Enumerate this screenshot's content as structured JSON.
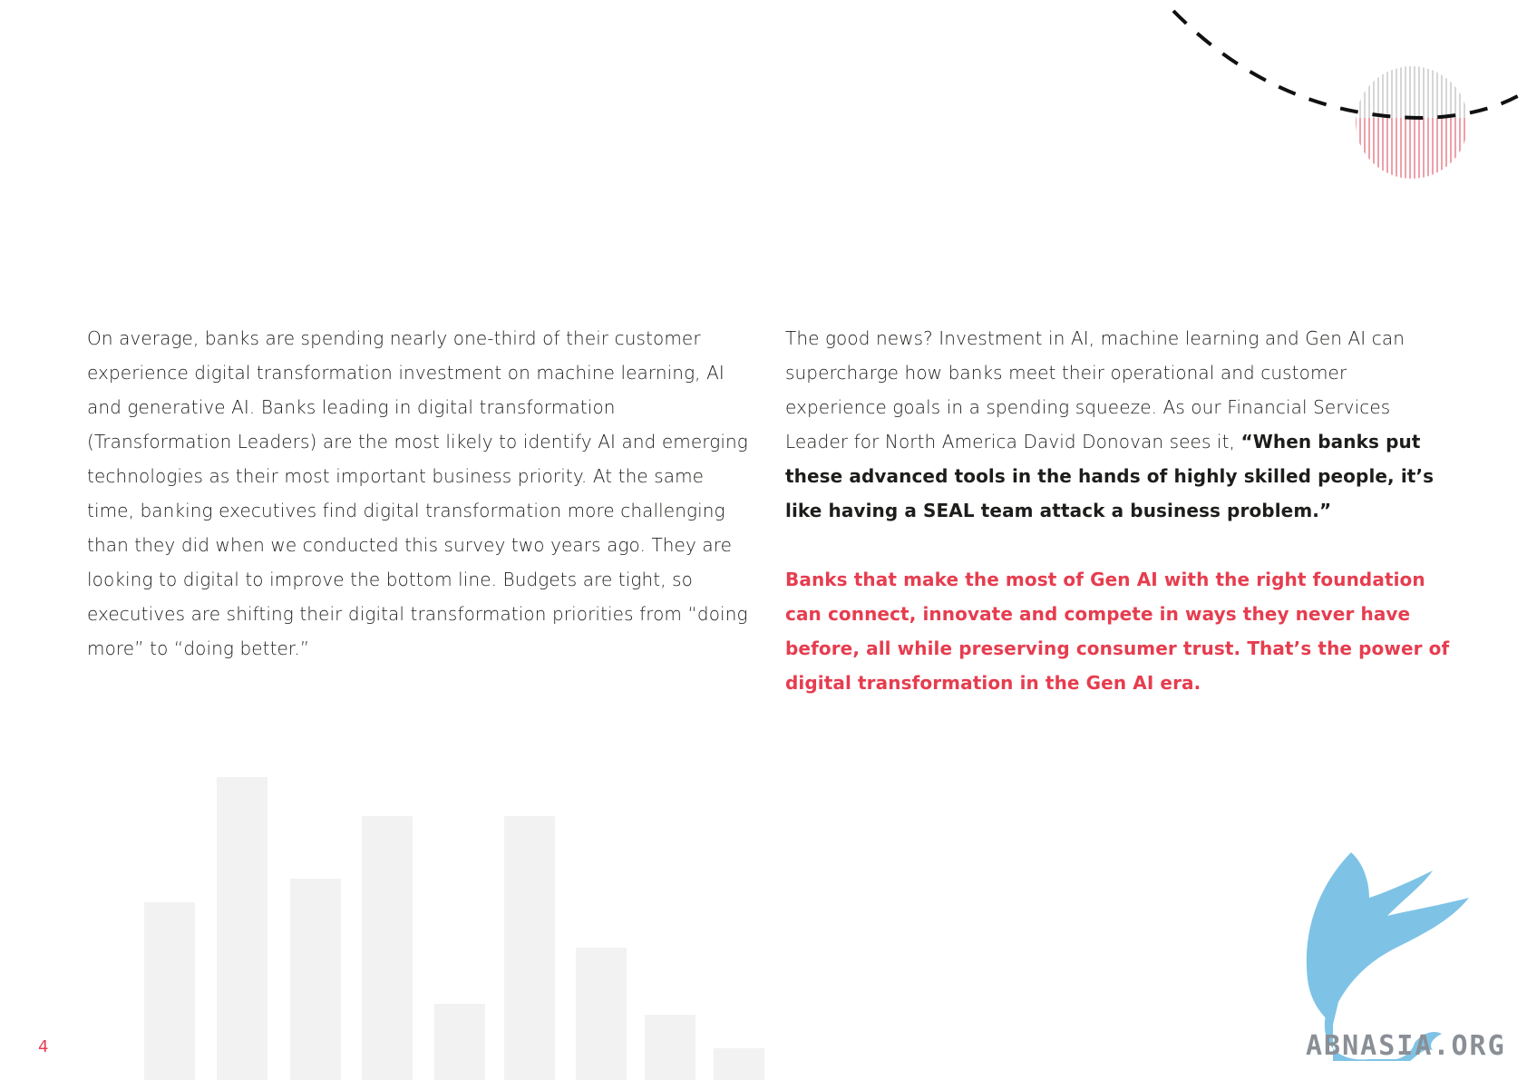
{
  "left_paragraph": "On average, banks are spending nearly one-third of their customer experience digital transformation investment on machine learning, AI and generative AI. Banks leading in digital transformation (Transformation Leaders) are the most likely to identify AI and emerging technologies as their most important business priority. At the same time, banking executives find digital transformation more challenging than they did when we conducted this survey two years ago. They are looking to digital to improve the bottom line. Budgets are tight, so executives are shifting their digital transformation priorities from “doing more” to “doing better.”",
  "right_intro": "The good news? Investment in AI, machine learning and Gen AI can supercharge how banks meet their operational and customer experience goals in a spending squeeze. As our Financial Services Leader for North America David Donovan sees it,",
  "right_quote": "“When banks put these advanced tools in the hands of highly skilled people, it’s like having a SEAL team attack a business problem.”",
  "callout": "Banks that make the most of Gen AI with the right foundation can connect, innovate and compete in ways they never have before, all while preserving consumer trust. That’s the power of digital transformation in the Gen AI era.",
  "page_number": "4",
  "watermark_text": "ABNASIA.ORG",
  "colors": {
    "accent": "#e63d4f",
    "text": "#1d1d1b",
    "deco_bar": "#f2f2f2",
    "watermark_blue": "#7ec3e6"
  }
}
